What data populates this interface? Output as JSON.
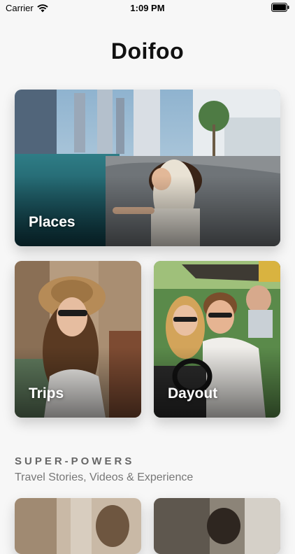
{
  "status_bar": {
    "carrier": "Carrier",
    "time": "1:09 PM"
  },
  "app": {
    "title": "Doifoo"
  },
  "cards": {
    "places": {
      "label": "Places"
    },
    "trips": {
      "label": "Trips"
    },
    "dayout": {
      "label": "Dayout"
    }
  },
  "section": {
    "title": "SUPER-POWERS",
    "subtitle": "Travel Stories, Videos & Experience"
  },
  "icons": {
    "wifi": "wifi-icon",
    "battery": "battery-icon"
  },
  "colors": {
    "background": "#f7f7f7",
    "card_label": "#ffffff",
    "section_title": "#666666"
  }
}
